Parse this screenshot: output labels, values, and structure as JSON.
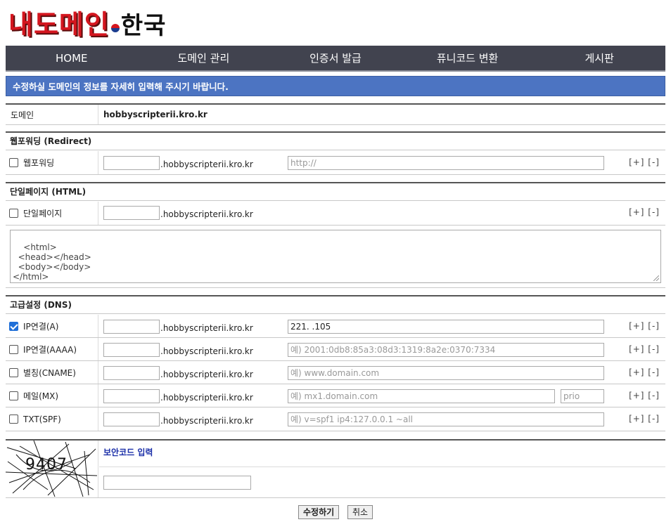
{
  "logo": {
    "main": "내도메인",
    "suffix": "한국"
  },
  "nav": [
    "HOME",
    "도메인 관리",
    "인증서 발급",
    "퓨니코드 변환",
    "게시판"
  ],
  "notice": "수정하실 도메인의 정보를 자세히 입력해 주시기 바랍니다.",
  "domain": {
    "label": "도메인",
    "value": "hobbyscripterii.kro.kr"
  },
  "suffix": ".hobbyscripterii.kro.kr",
  "plus_minus": "[+] [-]",
  "redirect": {
    "title": "웹포워딩 (Redirect)",
    "label": "웹포워딩",
    "url_placeholder": "http://"
  },
  "html_page": {
    "title": "단일페이지 (HTML)",
    "label": "단일페이지",
    "content": "<html>\n  <head></head>\n  <body></body>\n</html>"
  },
  "dns": {
    "title": "고급설정 (DNS)",
    "records": [
      {
        "label": "IP연결(A)",
        "checked": true,
        "value": "221.          .105"
      },
      {
        "label": "IP연결(AAAA)",
        "checked": false,
        "placeholder": "예) 2001:0db8:85a3:08d3:1319:8a2e:0370:7334"
      },
      {
        "label": "별칭(CNAME)",
        "checked": false,
        "placeholder": "예) www.domain.com"
      },
      {
        "label": "메일(MX)",
        "checked": false,
        "placeholder": "예) mx1.domain.com",
        "prio_placeholder": "prio"
      },
      {
        "label": "TXT(SPF)",
        "checked": false,
        "placeholder": "예) v=spf1 ip4:127.0.0.1 ~all"
      }
    ]
  },
  "captcha": {
    "title": "보안코드 입력",
    "code": "9407"
  },
  "buttons": {
    "submit": "수정하기",
    "cancel": "취소"
  },
  "colors": {
    "nav_bg": "#41434f",
    "notice_bg": "#4c74c2",
    "captcha_title": "#1a2ea8",
    "logo_red": "#d4161f"
  }
}
